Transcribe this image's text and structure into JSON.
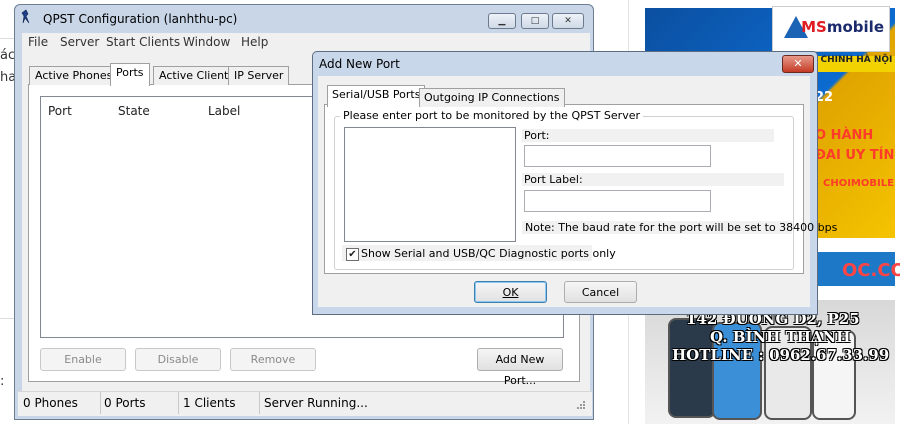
{
  "main_window": {
    "title": "QPST Configuration (lanhthu-pc)",
    "caption_buttons": {
      "minimize": "▁",
      "maximize": "□",
      "close": "✕"
    },
    "menu": [
      "File",
      "Server",
      "Start Clients",
      "Window",
      "Help"
    ],
    "tabs": [
      "Active Phones",
      "Ports",
      "Active Clients",
      "IP Server"
    ],
    "active_tab": "Ports",
    "columns": [
      "Port",
      "State",
      "Label"
    ],
    "buttons": {
      "enable": "Enable",
      "disable": "Disable",
      "remove": "Remove",
      "add_new_port": "Add New Port..."
    },
    "status": {
      "phones": "0 Phones",
      "ports": "0 Ports",
      "clients": "1 Clients",
      "server": "Server Running..."
    }
  },
  "dialog": {
    "title": "Add New Port",
    "close_glyph": "✕",
    "tabs": [
      "Serial/USB Ports",
      "Outgoing IP Connections"
    ],
    "active_tab": "Serial/USB Ports",
    "group_label": "Please enter port to be monitored by the QPST Server",
    "port_label": "Port:",
    "port_value": "",
    "port_label_label": "Port Label:",
    "port_label_value": "",
    "note": "Note: The baud rate for the port will be set to 38400 bps",
    "checkbox_label": "Show Serial and USB/QC Diagnostic ports only",
    "checkbox_checked": true,
    "ok": "OK",
    "cancel": "Cancel"
  },
  "background": {
    "left_fragments": [
      "ác",
      "ha",
      ":"
    ],
    "ad1": {
      "brand": "MS",
      "brand_rest": "mobile",
      "line1": "G CHINH HÀ NỘI",
      "line2": "22",
      "line3": "O HÀNH",
      "line4": "ĐAI UY TÍN",
      "line5": "CHOIMOBILE"
    },
    "ad2": {
      "text": "OC.COM"
    },
    "ad3": {
      "line1": "142 ĐƯỜNG D2, P25",
      "line2": "Q. BÌNH THẠNH",
      "line3": "HOTLINE : 0962.67.33.99"
    }
  }
}
